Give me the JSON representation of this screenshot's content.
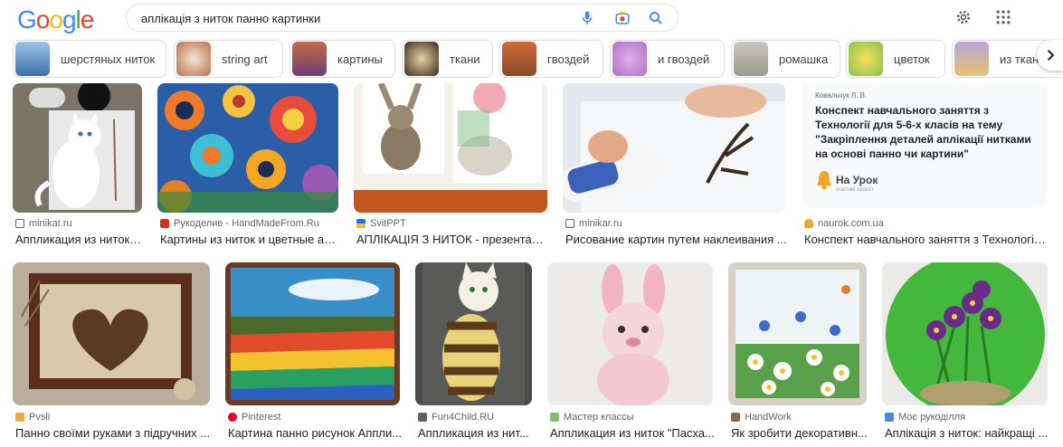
{
  "logo": {
    "letters": [
      "G",
      "o",
      "o",
      "g",
      "l",
      "e"
    ],
    "colors": [
      "#4285F4",
      "#EA4335",
      "#FBBC05",
      "#4285F4",
      "#34A853",
      "#EA4335"
    ]
  },
  "search": {
    "query": "аплікація з ниток панно картинки"
  },
  "icons": {
    "mic": "microphone-icon",
    "lens": "camera-lens-icon",
    "search": "search-icon",
    "settings": "gear-icon",
    "apps": "apps-grid-icon",
    "next": "chevron-right-icon"
  },
  "chips": [
    {
      "label": "шерстяных ниток"
    },
    {
      "label": "string art"
    },
    {
      "label": "картины"
    },
    {
      "label": "ткани"
    },
    {
      "label": "гвоздей"
    },
    {
      "label": "и гвоздей"
    },
    {
      "label": "ромашка"
    },
    {
      "label": "цветок"
    },
    {
      "label": "из ткан"
    }
  ],
  "row1": [
    {
      "source": "minikar.ru",
      "title": "Аппликация из ниток. ..."
    },
    {
      "source": "Рукоделие - HandMadeFrom.Ru",
      "title": "Картины из ниток и цветные ап..."
    },
    {
      "source": "SvitPPT",
      "title": "АПЛІКАЦІЯ З НИТОК - презентац..."
    },
    {
      "source": "minikar.ru",
      "title": "Рисование картин путем наклеивания ..."
    },
    {
      "source": "naurok.com.ua",
      "title": "Конспект навчального заняття з Технології ..."
    }
  ],
  "doc_card": {
    "author": "Ковальчук Л. В.",
    "title": "Конспект навчального заняття з Технології для 5-6-х класів на тему \"Закріплення деталей аплікації нитками на основі панно чи картини\"",
    "brand": "На Урок",
    "brand_sub": "освітній проєкт"
  },
  "row2": [
    {
      "source": "Pvsli",
      "title": "Панно своїми руками з підручних ..."
    },
    {
      "source": "Pinterest",
      "title": "Картина панно рисунок Аппли..."
    },
    {
      "source": "Fun4Child.RU",
      "title": "Аппликация из нит..."
    },
    {
      "source": "Мастер классы",
      "title": "Аппликация из ниток \"Пасха..."
    },
    {
      "source": "HandWork",
      "title": "Як зробити декоративн..."
    },
    {
      "source": "Моє рукоділля",
      "title": "Аплікація з ниток: найкращі ..."
    }
  ]
}
